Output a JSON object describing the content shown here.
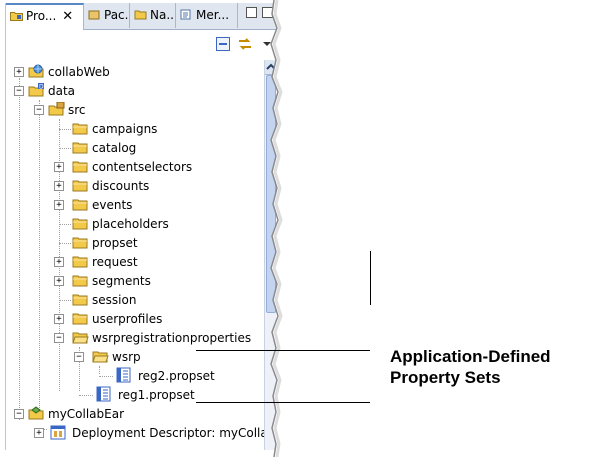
{
  "tabs": [
    {
      "label": "Pro...",
      "active": true,
      "close": "✕"
    },
    {
      "label": "Pac..."
    },
    {
      "label": "Na..."
    },
    {
      "label": "Mer..."
    }
  ],
  "toolbar": {
    "collapse_icon": "collapse-all-icon",
    "link_icon": "link-with-editor-icon"
  },
  "tree": [
    {
      "label": "collabWeb",
      "icon": "web-project-icon",
      "expander": "+"
    },
    {
      "label": "data",
      "icon": "data-project-icon",
      "expander": "−"
    },
    {
      "label": "src",
      "icon": "source-folder-icon",
      "expander": "−"
    },
    {
      "label": "campaigns",
      "icon": "folder-icon"
    },
    {
      "label": "catalog",
      "icon": "folder-icon"
    },
    {
      "label": "contentselectors",
      "icon": "folder-icon",
      "expander": "+"
    },
    {
      "label": "discounts",
      "icon": "folder-icon",
      "expander": "+"
    },
    {
      "label": "events",
      "icon": "folder-icon",
      "expander": "+"
    },
    {
      "label": "placeholders",
      "icon": "folder-icon"
    },
    {
      "label": "propset",
      "icon": "folder-icon"
    },
    {
      "label": "request",
      "icon": "folder-icon",
      "expander": "+"
    },
    {
      "label": "segments",
      "icon": "folder-icon",
      "expander": "+"
    },
    {
      "label": "session",
      "icon": "folder-icon"
    },
    {
      "label": "userprofiles",
      "icon": "folder-icon",
      "expander": "+"
    },
    {
      "label": "wsrpregistrationproperties",
      "icon": "folder-icon",
      "expander": "−"
    },
    {
      "label": "wsrp",
      "icon": "folder-icon",
      "expander": "−"
    },
    {
      "label": "reg2.propset",
      "icon": "propset-file-icon"
    },
    {
      "label": "reg1.propset",
      "icon": "propset-file-icon"
    },
    {
      "label": "myCollabEar",
      "icon": "ear-project-icon",
      "expander": "−"
    },
    {
      "label": "Deployment Descriptor: myCollabE...",
      "icon": "deployment-descriptor-icon",
      "expander": "+"
    }
  ],
  "callout": {
    "line1": "Application-Defined",
    "line2": "Property Sets"
  },
  "colors": {
    "tab_bar": "#dfe6ef",
    "folder": "#f3c94a",
    "scroll_thumb": "#c3d3f0",
    "propset_icon": "#3a66c4"
  }
}
